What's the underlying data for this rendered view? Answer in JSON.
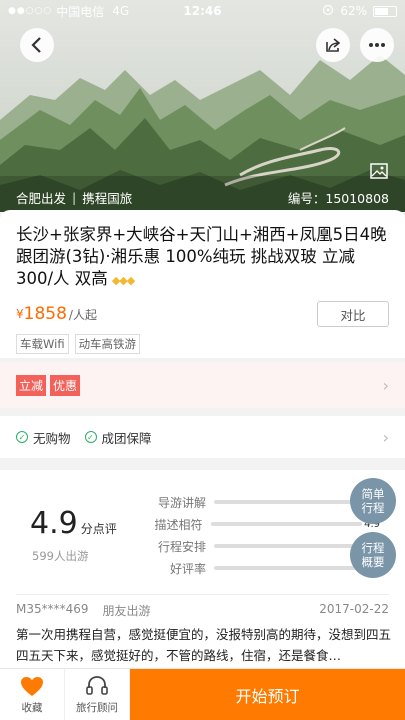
{
  "status_bar": {
    "carrier": "中国电信",
    "network": "4G",
    "time": "12:46",
    "battery": "62%"
  },
  "hero": {
    "departure": "合肥出发",
    "agency": "携程国旅",
    "code_label": "编号：15010808"
  },
  "product": {
    "title": "长沙+张家界+大峡谷+天门山+湘西+凤凰5日4晚跟团游(3钻)·湘乐惠 100%纯玩 挑战双玻 立减300/人 双高",
    "diamonds": "◆◆◆",
    "price_currency": "¥",
    "price": "1858",
    "price_unit": "/人起",
    "compare_label": "对比",
    "tags": [
      "车载Wifi",
      "动车高铁游"
    ]
  },
  "promo": {
    "tags": [
      "立减",
      "优惠"
    ]
  },
  "guarantees": {
    "items": [
      "无购物",
      "成团保障"
    ]
  },
  "reviews": {
    "score": "4.9",
    "score_unit": "分点评",
    "tour_count": "599人出游",
    "ratings": [
      {
        "label": "导游讲解",
        "value": ""
      },
      {
        "label": "描述相符",
        "value": "4.9"
      },
      {
        "label": "行程安排",
        "value": ""
      },
      {
        "label": "好评率",
        "value": ""
      }
    ],
    "bubble_simple": "简单行程",
    "bubble_overview": "行程概要",
    "first": {
      "user": "M35****469",
      "type": "朋友出游",
      "date": "2017-02-22",
      "text": "第一次用携程自营，感觉挺便宜的，没报特别高的期待，没想到四五四五天下来，感觉挺好的，不管的路线，住宿，还是餐食…"
    }
  },
  "bottom": {
    "favorite_label": "收藏",
    "consult_label": "旅行顾问",
    "book_label": "开始预订"
  },
  "colors": {
    "accent": "#ff7a00",
    "promo_red": "#f2625a",
    "check_green": "#2bae66",
    "bubble": "#7a95a8"
  }
}
